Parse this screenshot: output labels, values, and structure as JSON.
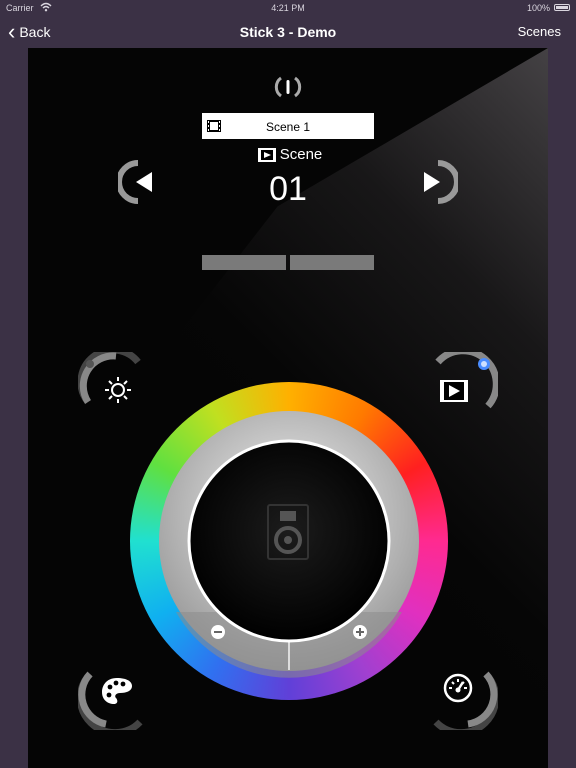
{
  "status": {
    "carrier": "Carrier",
    "time": "4:21 PM",
    "battery": "100%"
  },
  "nav": {
    "back_label": "Back",
    "title": "Stick 3 - Demo",
    "scenes_label": "Scenes"
  },
  "scene": {
    "selected": "Scene 1",
    "caption": "Scene",
    "number": "01"
  },
  "icons": {
    "power": "power-icon",
    "prev": "prev-arrow-icon",
    "next": "next-arrow-icon",
    "brightness": "sun-icon",
    "scene_mode": "film-play-icon",
    "palette": "palette-icon",
    "speed": "speedometer-icon",
    "speaker": "speaker-icon"
  },
  "colors": {
    "nav_bg": "#3b3145",
    "panel_bg": "#050505",
    "indicator": "#4a8cff"
  }
}
